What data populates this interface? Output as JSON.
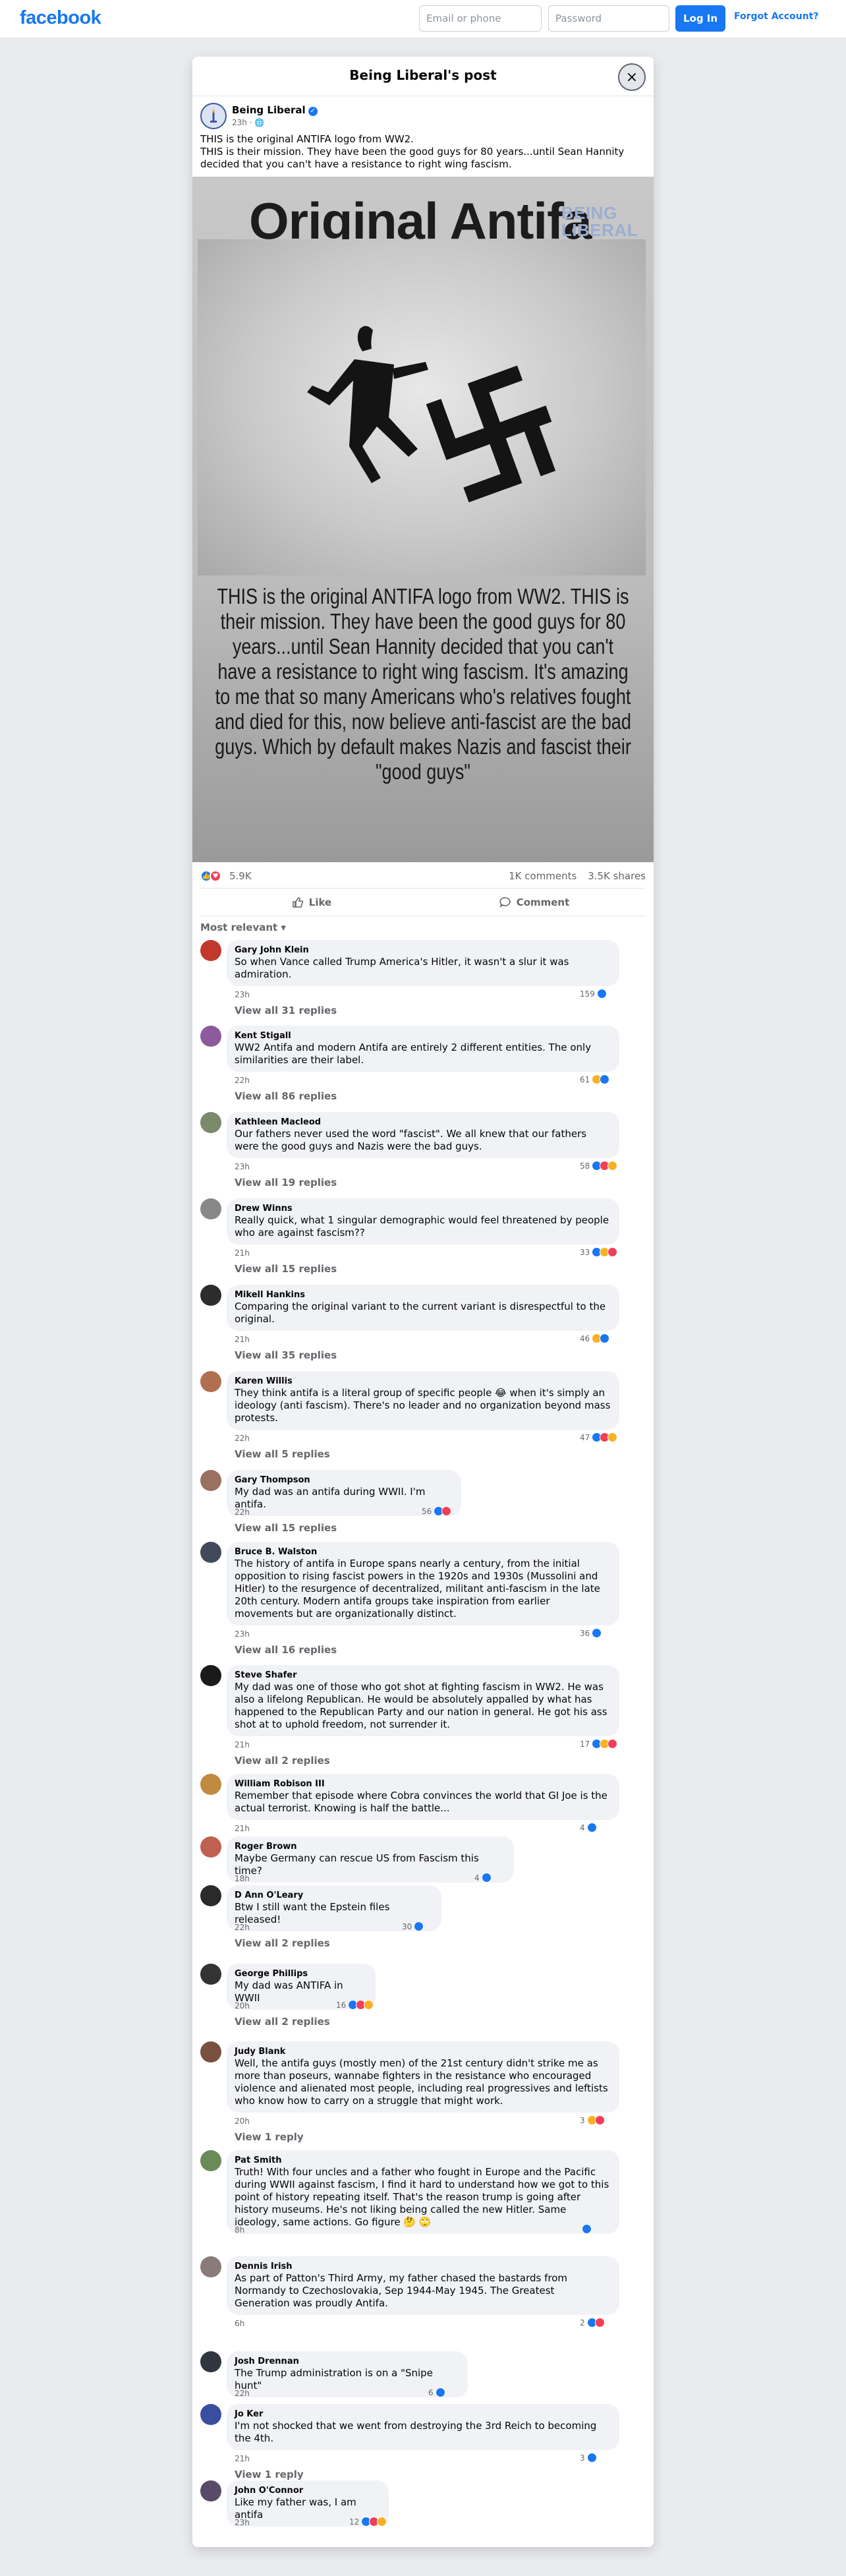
{
  "header": {
    "logo": "facebook",
    "email_placeholder": "Email or phone",
    "password_placeholder": "Password",
    "login_label": "Log In",
    "forgot_label": "Forgot Account?"
  },
  "modal": {
    "title": "Being Liberal's post",
    "close_icon": "×"
  },
  "post": {
    "page_name": "Being Liberal",
    "meta": "23h · ",
    "text_line1": "THIS is the original ANTIFA logo from WW2.",
    "text_line2": "THIS is their mission. They have been the good guys for 80 years...until Sean Hannity decided that you can't have a resistance to right wing fascism.",
    "image": {
      "title": "Original Antifa",
      "watermark_line1": "BEING",
      "watermark_line2": "LIBERAL",
      "caption": "THIS is the original ANTIFA logo from WW2. THIS is their mission. They have been the good guys for 80 years...until Sean Hannity decided that you can't have a resistance to right wing fascism. It's amazing to me that so many Americans who's relatives fought and died for this, now believe anti-fascist are the bad guys. Which by default makes Nazis and fascist their \"good guys\""
    },
    "reaction_count": "5.9K",
    "comments_count": "1K comments",
    "shares_count": "3.5K shares",
    "like_label": "Like",
    "comment_label": "Comment",
    "sort_label": "Most relevant ▾"
  },
  "comments": [
    {
      "name": "Gary John Klein",
      "text": "So when Vance called Trump America's Hitler, it wasn't a slur it was admiration.",
      "time": "23h",
      "reactions": "159",
      "replies": "View all 31 replies"
    },
    {
      "name": "Kent Stigall",
      "text": "WW2 Antifa and modern Antifa are entirely 2 different entities. The only similarities are their label.",
      "time": "22h",
      "reactions": "61",
      "replies": "View all 86 replies"
    },
    {
      "name": "Kathleen Macleod",
      "text": "Our fathers never used the word \"fascist\". We all knew that our fathers were the good guys and Nazis were the bad guys.",
      "time": "23h",
      "reactions": "58",
      "replies": "View all 19 replies"
    },
    {
      "name": "Drew Winns",
      "text": "Really quick, what 1 singular demographic would feel threatened by people who are against fascism??",
      "time": "21h",
      "reactions": "33",
      "replies": "View all 15 replies"
    },
    {
      "name": "Mikell Hankins",
      "text": "Comparing the original variant to the current variant is disrespectful to the original.",
      "time": "21h",
      "reactions": "46",
      "replies": "View all 35 replies"
    },
    {
      "name": "Karen Willis",
      "text": "They think antifa is a literal group of specific people 😂 when it's simply an ideology (anti fascism). There's no leader and no organization beyond mass protests.",
      "time": "22h",
      "reactions": "47",
      "replies": "View all 5 replies"
    },
    {
      "name": "Gary Thompson",
      "text": "My dad was an antifa during WWII. I'm antifa.",
      "time": "22h",
      "reactions": "56",
      "replies": "View all 15 replies"
    },
    {
      "name": "Bruce B. Walston",
      "text": "The history of antifa in Europe spans nearly a century, from the initial opposition to rising fascist powers in the 1920s and 1930s (Mussolini and Hitler) to the resurgence of decentralized, militant anti-fascism in the late 20th century. Modern antifa groups take inspiration from earlier movements but are organizationally distinct.",
      "time": "23h",
      "reactions": "36",
      "replies": "View all 16 replies"
    },
    {
      "name": "Steve Shafer",
      "text": "My dad was one of those who got shot at fighting fascism in WW2. He was also a lifelong Republican. He would be absolutely appalled by what has happened to the Republican Party and our nation in general. He got his ass shot at to uphold freedom, not surrender it.",
      "time": "21h",
      "reactions": "17",
      "replies": "View all 2 replies"
    },
    {
      "name": "William Robison III",
      "text": "Remember that episode where Cobra convinces the world that GI Joe is the actual terrorist. Knowing is half the battle...",
      "time": "21h",
      "reactions": "4",
      "replies": ""
    },
    {
      "name": "Roger Brown",
      "text": "Maybe Germany can rescue US from Fascism this time?",
      "time": "18h",
      "reactions": "4",
      "replies": ""
    },
    {
      "name": "D Ann O'Leary",
      "text": "Btw I still want the Epstein files released!",
      "time": "22h",
      "reactions": "30",
      "replies": "View all 2 replies"
    },
    {
      "name": "George Phillips",
      "text": "My dad was ANTIFA in WWII",
      "time": "20h",
      "reactions": "16",
      "replies": "View all 2 replies"
    },
    {
      "name": "Judy Blank",
      "text": "Well, the antifa guys (mostly men) of the 21st century didn't strike me as more than poseurs, wannabe fighters in the resistance who encouraged violence and alienated most people, including real progressives and leftists who know how to carry on a struggle that might work.",
      "time": "20h",
      "reactions": "3",
      "replies": "View 1 reply"
    },
    {
      "name": "Pat Smith",
      "text": "Truth! With four uncles and a father who fought in Europe and the Pacific during WWII against fascism, I find it hard to understand how we got to this point of history repeating itself. That's the reason trump is going after history museums. He's not liking being called the new Hitler. Same ideology, same actions. Go figure 🤔 🙄",
      "time": "8h",
      "reactions": "",
      "replies": ""
    },
    {
      "name": "Dennis Irish",
      "text": "As part of Patton's Third Army, my father chased the bastards from Normandy to Czechoslovakia, Sep 1944-May 1945. The Greatest Generation was proudly Antifa.",
      "time": "6h",
      "reactions": "2",
      "replies": ""
    },
    {
      "name": "Josh Drennan",
      "text": "The Trump administration is on a \"Snipe hunt\"",
      "time": "22h",
      "reactions": "6",
      "replies": ""
    },
    {
      "name": "Jo Ker",
      "text": "I'm not shocked that we went from destroying the 3rd Reich to becoming the 4th.",
      "time": "21h",
      "reactions": "3",
      "replies": "View 1 reply"
    },
    {
      "name": "John O'Connor",
      "text": "Like my father was, I am antifa",
      "time": "23h",
      "reactions": "12",
      "replies": ""
    }
  ]
}
